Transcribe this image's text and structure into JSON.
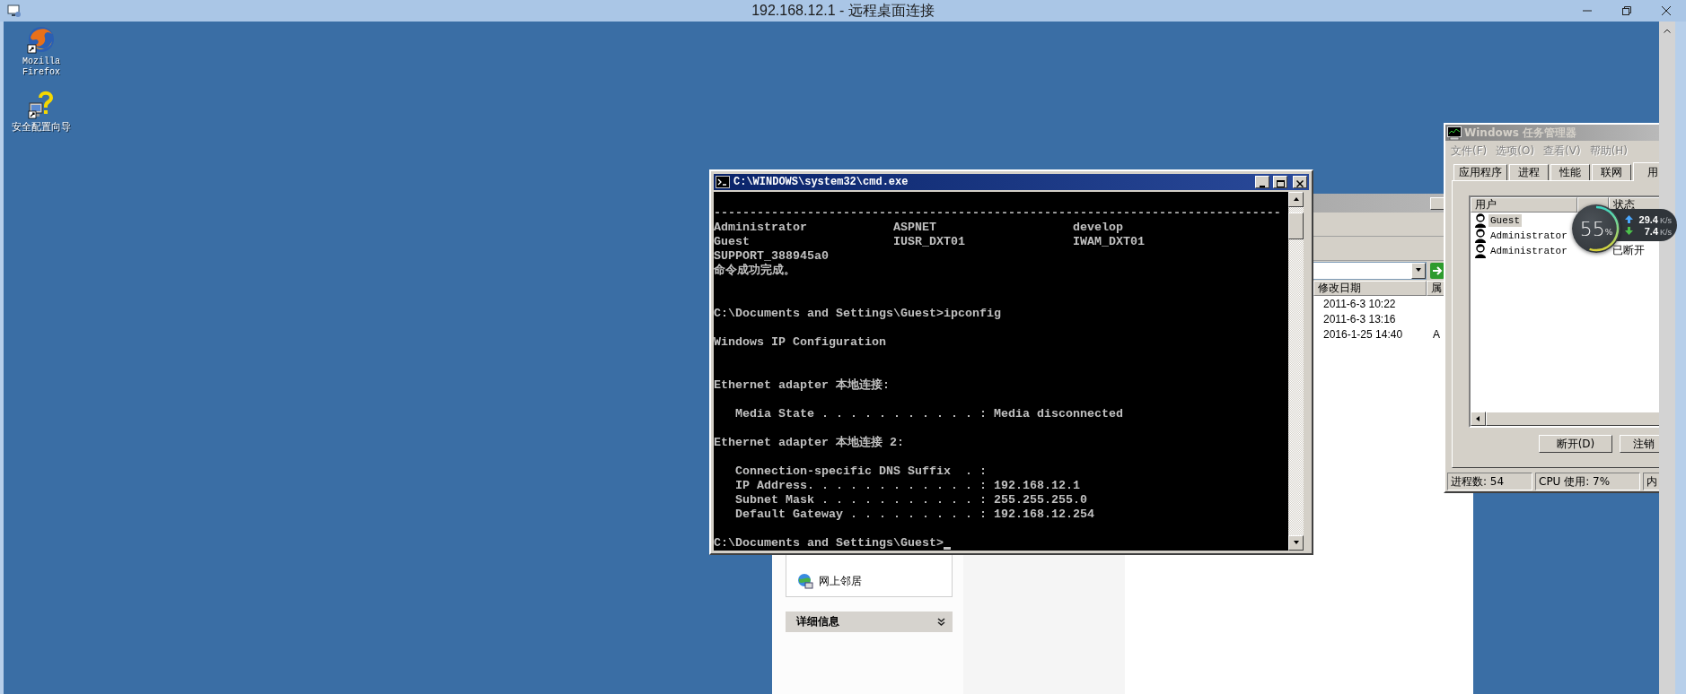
{
  "rdp_window": {
    "title": "192.168.12.1 - 远程桌面连接"
  },
  "desktop_icons": [
    {
      "label": "Mozilla Firefox",
      "kind": "browser"
    },
    {
      "label": "安全配置向导",
      "kind": "wizard"
    }
  ],
  "explorer": {
    "sidebar": {
      "places": [
        {
          "label": "网上邻居"
        }
      ],
      "details_header": "详细信息"
    },
    "columns": [
      {
        "label": "修改日期"
      },
      {
        "label": "属"
      }
    ],
    "rows": [
      {
        "modified": "2011-6-3 10:22"
      },
      {
        "modified": "2011-6-3 13:16"
      },
      {
        "modified": "2016-1-25 14:40",
        "attribute": "A"
      }
    ]
  },
  "console": {
    "title": "C:\\WINDOWS\\system32\\cmd.exe",
    "lines": [
      {
        "kind": "blank"
      },
      {
        "kind": "text",
        "text": "-------------------------------------------------------------------------------"
      },
      {
        "kind": "text",
        "text": "Administrator            ASPNET                   develop"
      },
      {
        "kind": "text",
        "text": "Guest                    IUSR_DXT01               IWAM_DXT01"
      },
      {
        "kind": "text",
        "text": "SUPPORT_388945a0"
      },
      {
        "kind": "text",
        "text": "命令成功完成。"
      },
      {
        "kind": "blank"
      },
      {
        "kind": "blank"
      },
      {
        "kind": "text",
        "text": "C:\\Documents and Settings\\Guest>ipconfig"
      },
      {
        "kind": "blank"
      },
      {
        "kind": "text",
        "text": "Windows IP Configuration"
      },
      {
        "kind": "blank"
      },
      {
        "kind": "blank"
      },
      {
        "kind": "text",
        "text": "Ethernet adapter 本地连接:"
      },
      {
        "kind": "blank"
      },
      {
        "kind": "text",
        "text": "   Media State . . . . . . . . . . . : Media disconnected"
      },
      {
        "kind": "blank"
      },
      {
        "kind": "text",
        "text": "Ethernet adapter 本地连接 2:"
      },
      {
        "kind": "blank"
      },
      {
        "kind": "text",
        "text": "   Connection-specific DNS Suffix  . :"
      },
      {
        "kind": "text",
        "text": "   IP Address. . . . . . . . . . . . : 192.168.12.1"
      },
      {
        "kind": "text",
        "text": "   Subnet Mask . . . . . . . . . . . : 255.255.255.0"
      },
      {
        "kind": "text",
        "text": "   Default Gateway . . . . . . . . . : 192.168.12.254"
      },
      {
        "kind": "blank"
      },
      {
        "kind": "prompt",
        "text": "C:\\Documents and Settings\\Guest>"
      }
    ]
  },
  "task_manager": {
    "title": "Windows 任务管理器",
    "menu": [
      "文件(F)",
      "选项(O)",
      "查看(V)",
      "帮助(H)"
    ],
    "tabs": [
      {
        "label": "应用程序",
        "selected": false
      },
      {
        "label": "进程",
        "selected": false
      },
      {
        "label": "性能",
        "selected": false
      },
      {
        "label": "联网",
        "selected": false
      },
      {
        "label": "用",
        "selected": true
      }
    ],
    "users": {
      "columns": [
        "用户",
        "状态"
      ],
      "rows": [
        {
          "name": "Guest",
          "selected": true
        },
        {
          "name": "Administrator",
          "selected": false
        },
        {
          "name": "Administrator",
          "status": "已断开",
          "selected": false
        }
      ]
    },
    "buttons": [
      "断开(D)",
      "注销"
    ],
    "status_bar": [
      "进程数: 54",
      "CPU 使用: 7%",
      "内"
    ]
  },
  "speed_widget": {
    "percent": "55",
    "percent_sign": "%",
    "level": 0.55,
    "upload": "29.4",
    "upload_unit": "K/s",
    "download": "7.4",
    "download_unit": "K/s"
  }
}
